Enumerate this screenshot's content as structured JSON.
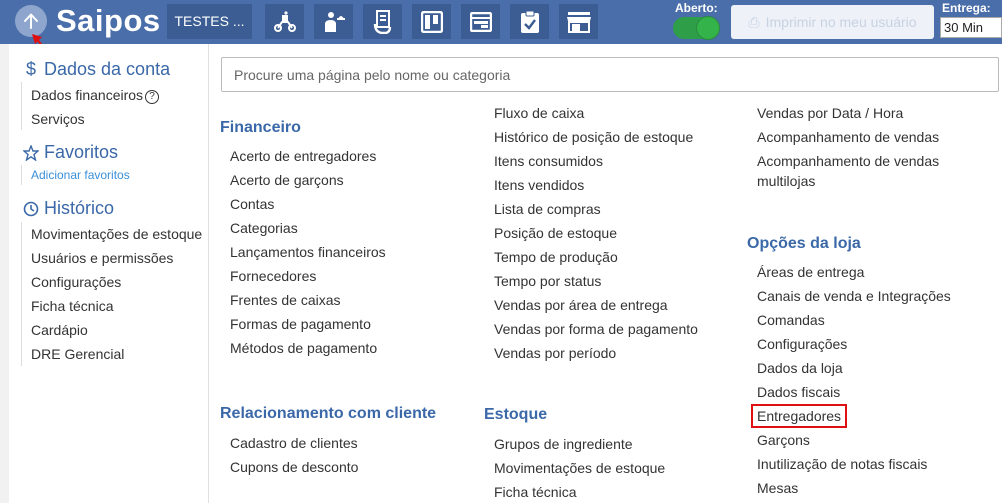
{
  "header": {
    "brand": "Saipos",
    "store_label": "TESTES ...",
    "tools": [
      {
        "name": "delivery-icon"
      },
      {
        "name": "waiter-icon"
      },
      {
        "name": "order-pad-icon"
      },
      {
        "name": "kanban-icon"
      },
      {
        "name": "display-icon"
      },
      {
        "name": "checklist-icon"
      },
      {
        "name": "store-icon"
      }
    ],
    "open_label": "Aberto:",
    "print_label": "Imprimir no meu usuário",
    "delivery_label": "Entrega:",
    "delivery_value": "30 Min",
    "colors": {
      "bar": "#4a6ea9",
      "button": "#3b5d93",
      "toggle": "#34b34a"
    }
  },
  "sidebar": {
    "account_title": "Dados da conta",
    "account_items": [
      "Dados financeiros",
      "Serviços"
    ],
    "favorites_title": "Favoritos",
    "favorites_add": "Adicionar favoritos",
    "history_title": "Histórico",
    "history_items": [
      "Movimentações de estoque",
      "Usuários e permissões",
      "Configurações",
      "Ficha técnica",
      "Cardápio",
      "DRE Gerencial"
    ]
  },
  "search": {
    "placeholder": "Procure uma página pelo nome ou categoria"
  },
  "menu": {
    "financeiro": {
      "title": "Financeiro",
      "items": [
        "Acerto de entregadores",
        "Acerto de garçons",
        "Contas",
        "Categorias",
        "Lançamentos financeiros",
        "Fornecedores",
        "Frentes de caixas",
        "Formas de pagamento",
        "Métodos de pagamento"
      ]
    },
    "relatorios_col2": {
      "items": [
        "Fluxo de caixa",
        "Histórico de posição de estoque",
        "Itens consumidos",
        "Itens vendidos",
        "Lista de compras",
        "Posição de estoque",
        "Tempo de produção",
        "Tempo por status",
        "Vendas por área de entrega",
        "Vendas por forma de pagamento",
        "Vendas por período"
      ]
    },
    "relatorios_col3": {
      "items": [
        "Vendas por Data / Hora",
        "Acompanhamento de vendas",
        "Acompanhamento de vendas multilojas"
      ]
    },
    "relacionamento": {
      "title": "Relacionamento com cliente",
      "items": [
        "Cadastro de clientes",
        "Cupons de desconto"
      ]
    },
    "estoque": {
      "title": "Estoque",
      "items": [
        "Grupos de ingrediente",
        "Movimentações de estoque",
        "Ficha técnica"
      ]
    },
    "opcoes_loja": {
      "title": "Opções da loja",
      "items": [
        "Áreas de entrega",
        "Canais de venda e Integrações",
        "Comandas",
        "Configurações",
        "Dados da loja",
        "Dados fiscais",
        "Entregadores",
        "Garçons",
        "Inutilização de notas fiscais",
        "Mesas"
      ],
      "highlighted": "Entregadores"
    }
  }
}
